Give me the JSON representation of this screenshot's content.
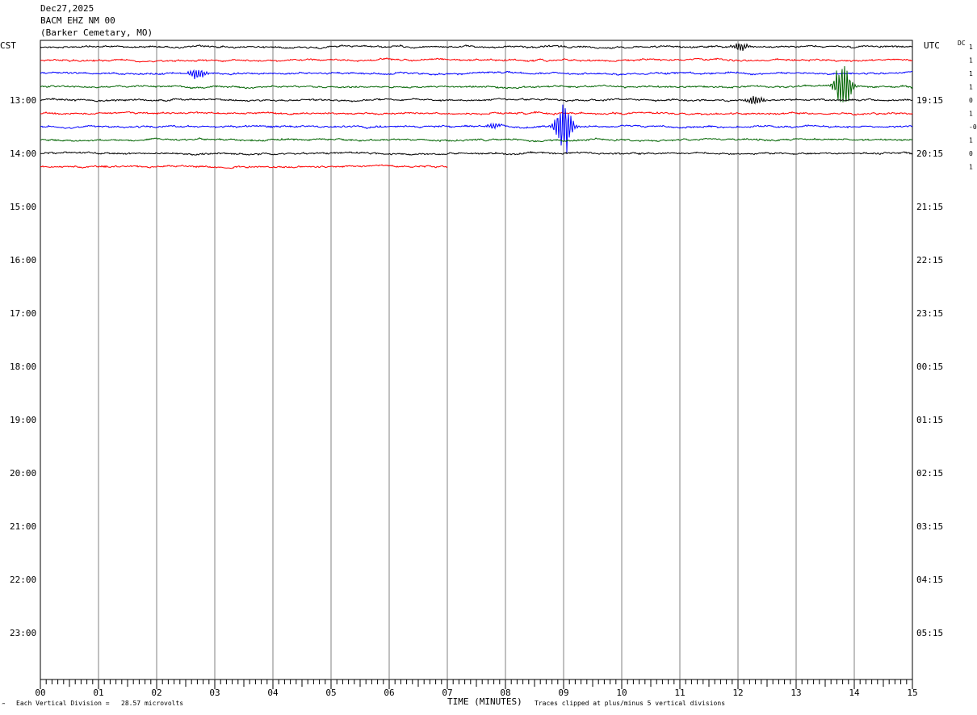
{
  "header": {
    "date": "Dec27,2025",
    "station": "BACM EHZ NM 00",
    "location": "(Barker Cemetary, MO)"
  },
  "left_tz": "CST",
  "right_tz": "UTC",
  "dc_label": "DC",
  "footer": {
    "corner_mark": "‴",
    "vertical_division": "Each Vertical Division =   28.57 microvolts",
    "clipping_note": "Traces clipped at plus/minus 5 vertical divisions"
  },
  "chart_data": {
    "type": "line",
    "title": "BACM EHZ NM 00 (Barker Cemetary, MO)",
    "xlabel": "TIME (MINUTES)",
    "ylabel": "",
    "xlim": [
      0,
      15
    ],
    "x_ticks": [
      "00",
      "01",
      "02",
      "03",
      "04",
      "05",
      "06",
      "07",
      "08",
      "09",
      "10",
      "11",
      "12",
      "13",
      "14",
      "15"
    ],
    "left_hour_labels": [
      "13:00",
      "14:00",
      "15:00",
      "16:00",
      "17:00",
      "18:00",
      "19:00",
      "20:00",
      "21:00",
      "22:00",
      "23:00"
    ],
    "right_hour_labels": [
      "19:15",
      "20:15",
      "21:15",
      "22:15",
      "23:15",
      "00:15",
      "01:15",
      "02:15",
      "03:15",
      "04:15",
      "05:15"
    ],
    "grid": true,
    "trace_colors": [
      "#000000",
      "#ff0000",
      "#0000ff",
      "#006400"
    ],
    "traces": [
      {
        "color": "#000000",
        "dc": "1",
        "end_minute": 15,
        "events": [
          {
            "minute": 12.05,
            "amplitude": 0.6
          }
        ]
      },
      {
        "color": "#ff0000",
        "dc": "1",
        "end_minute": 15,
        "events": []
      },
      {
        "color": "#0000ff",
        "dc": "1",
        "end_minute": 15,
        "events": [
          {
            "minute": 2.7,
            "amplitude": 0.8
          }
        ]
      },
      {
        "color": "#006400",
        "dc": "1",
        "end_minute": 15,
        "events": [
          {
            "minute": 13.8,
            "amplitude": 3.2
          }
        ]
      },
      {
        "color": "#000000",
        "dc": "0",
        "end_minute": 15,
        "events": [
          {
            "minute": 12.3,
            "amplitude": 0.6
          }
        ]
      },
      {
        "color": "#ff0000",
        "dc": "1",
        "end_minute": 15,
        "events": []
      },
      {
        "color": "#0000ff",
        "dc": "-0",
        "end_minute": 15,
        "events": [
          {
            "minute": 9.0,
            "amplitude": 3.6
          },
          {
            "minute": 7.8,
            "amplitude": 0.4
          }
        ]
      },
      {
        "color": "#006400",
        "dc": "1",
        "end_minute": 15,
        "events": []
      },
      {
        "color": "#000000",
        "dc": "0",
        "end_minute": 15,
        "events": []
      },
      {
        "color": "#ff0000",
        "dc": "1",
        "end_minute": 7,
        "events": []
      }
    ]
  }
}
